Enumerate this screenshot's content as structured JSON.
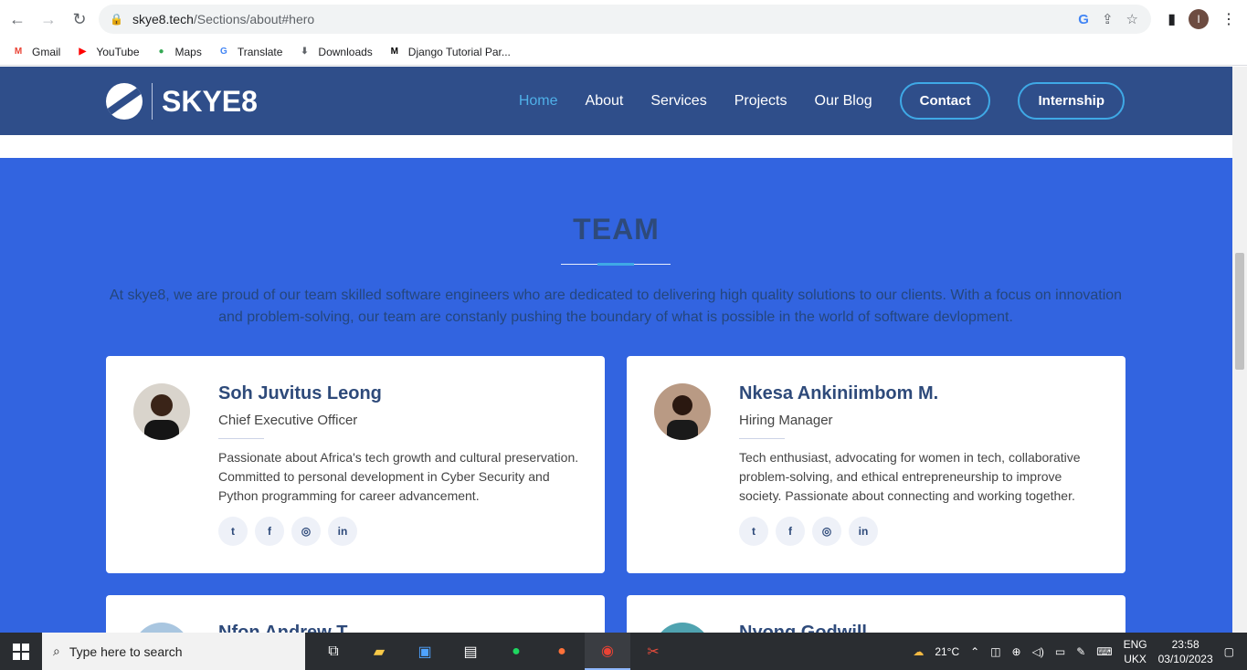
{
  "browser": {
    "url_host": "skye8.tech",
    "url_path": "/Sections/about#hero",
    "avatar_letter": "I",
    "bookmarks": [
      {
        "label": "Gmail",
        "icon": "gmail-icon",
        "color": "#ea4335",
        "glyph": "M"
      },
      {
        "label": "YouTube",
        "icon": "youtube-icon",
        "color": "#ff0000",
        "glyph": "▶"
      },
      {
        "label": "Maps",
        "icon": "maps-icon",
        "color": "#34a853",
        "glyph": "●"
      },
      {
        "label": "Translate",
        "icon": "translate-icon",
        "color": "#4285f4",
        "glyph": "G"
      },
      {
        "label": "Downloads",
        "icon": "download-icon",
        "color": "#5f6368",
        "glyph": "⬇"
      },
      {
        "label": "Django Tutorial Par...",
        "icon": "django-icon",
        "color": "#000000",
        "glyph": "M"
      }
    ]
  },
  "site": {
    "logo_text": "SKYE8",
    "menu": [
      {
        "label": "Home",
        "active": true
      },
      {
        "label": "About",
        "active": false
      },
      {
        "label": "Services",
        "active": false
      },
      {
        "label": "Projects",
        "active": false
      },
      {
        "label": "Our Blog",
        "active": false
      }
    ],
    "contact_label": "Contact",
    "internship_label": "Internship",
    "colors": {
      "header": "#2f4e8a",
      "section": "#3264e0",
      "accent": "#3fa9e6"
    }
  },
  "team": {
    "title": "TEAM",
    "intro": "At skye8, we are proud of our team skilled software engineers who are dedicated to delivering high quality solutions to our clients. With a focus on innovation and problem-solving, our team are constanly pushing the boundary of what is possible in the world of software devlopment.",
    "members": [
      {
        "name": "Soh Juvitus Leong",
        "role": "Chief Executive Officer",
        "description": "Passionate about Africa's tech growth and cultural preservation. Committed to personal development in Cyber Security and Python programming for career advancement."
      },
      {
        "name": "Nkesa Ankiniimbom M.",
        "role": "Hiring Manager",
        "description": "Tech enthusiast, advocating for women in tech, collaborative problem-solving, and ethical entrepreneurship to improve society. Passionate about connecting and working together."
      },
      {
        "name": "Nfon Andrew T.",
        "role": "",
        "description": ""
      },
      {
        "name": "Nyong Godwill",
        "role": "",
        "description": ""
      }
    ],
    "social_icons": [
      "twitter-icon",
      "facebook-icon",
      "instagram-icon",
      "linkedin-icon"
    ]
  },
  "taskbar": {
    "search_placeholder": "Type here to search",
    "weather": "21°C",
    "lang_top": "ENG",
    "lang_bottom": "UKX",
    "time": "23:58",
    "date": "03/10/2023"
  }
}
